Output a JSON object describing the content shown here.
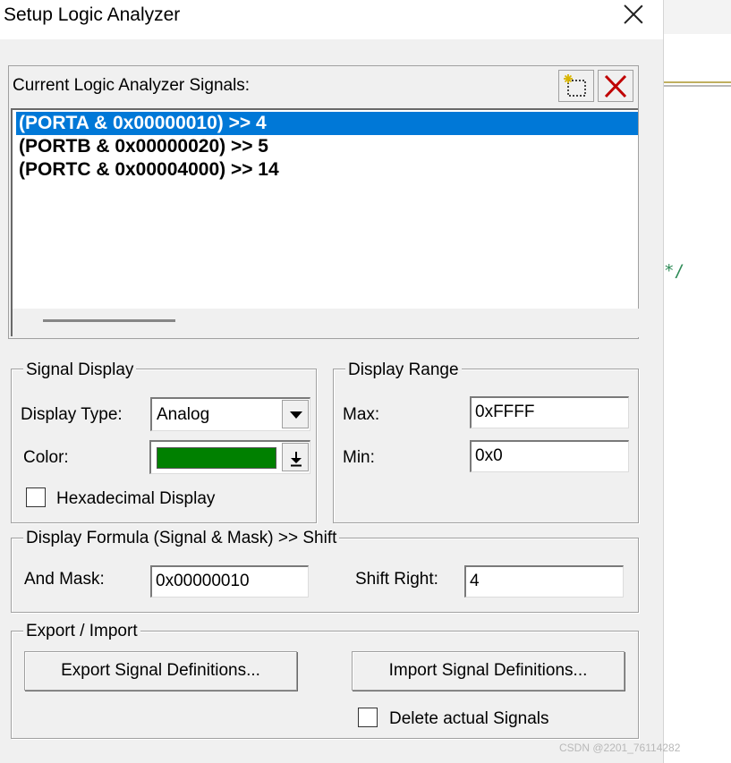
{
  "window": {
    "title": "Setup Logic Analyzer"
  },
  "background_editor": {
    "code_fragment": "*/"
  },
  "signals_panel": {
    "label": "Current Logic Analyzer Signals:",
    "items": [
      {
        "text": "(PORTA & 0x00000010) >> 4",
        "selected": true
      },
      {
        "text": "(PORTB & 0x00000020) >> 5",
        "selected": false
      },
      {
        "text": "(PORTC & 0x00004000) >> 14",
        "selected": false
      }
    ],
    "toolbar": {
      "new_icon": "new-signal-icon",
      "delete_icon": "delete-signal-icon"
    }
  },
  "signal_display": {
    "legend": "Signal Display",
    "display_type_label": "Display Type:",
    "display_type_value": "Analog",
    "color_label": "Color:",
    "color_value": "#008000",
    "hex_display_label": "Hexadecimal Display",
    "hex_display_checked": false
  },
  "display_range": {
    "legend": "Display Range",
    "max_label": "Max:",
    "max_value": "0xFFFF",
    "min_label": "Min:",
    "min_value": "0x0"
  },
  "display_formula": {
    "legend": "Display Formula (Signal & Mask) >> Shift",
    "and_mask_label": "And Mask:",
    "and_mask_value": "0x00000010",
    "shift_right_label": "Shift Right:",
    "shift_right_value": "4"
  },
  "export_import": {
    "legend": "Export / Import",
    "export_button": "Export Signal Definitions...",
    "import_button": "Import Signal Definitions...",
    "delete_actual_label": "Delete actual Signals",
    "delete_actual_checked": false
  },
  "watermark": "CSDN @2201_76114282",
  "colors": {
    "selection": "#0078d7",
    "dialog_bg": "#f0f0f0",
    "signal_color": "#008000"
  }
}
